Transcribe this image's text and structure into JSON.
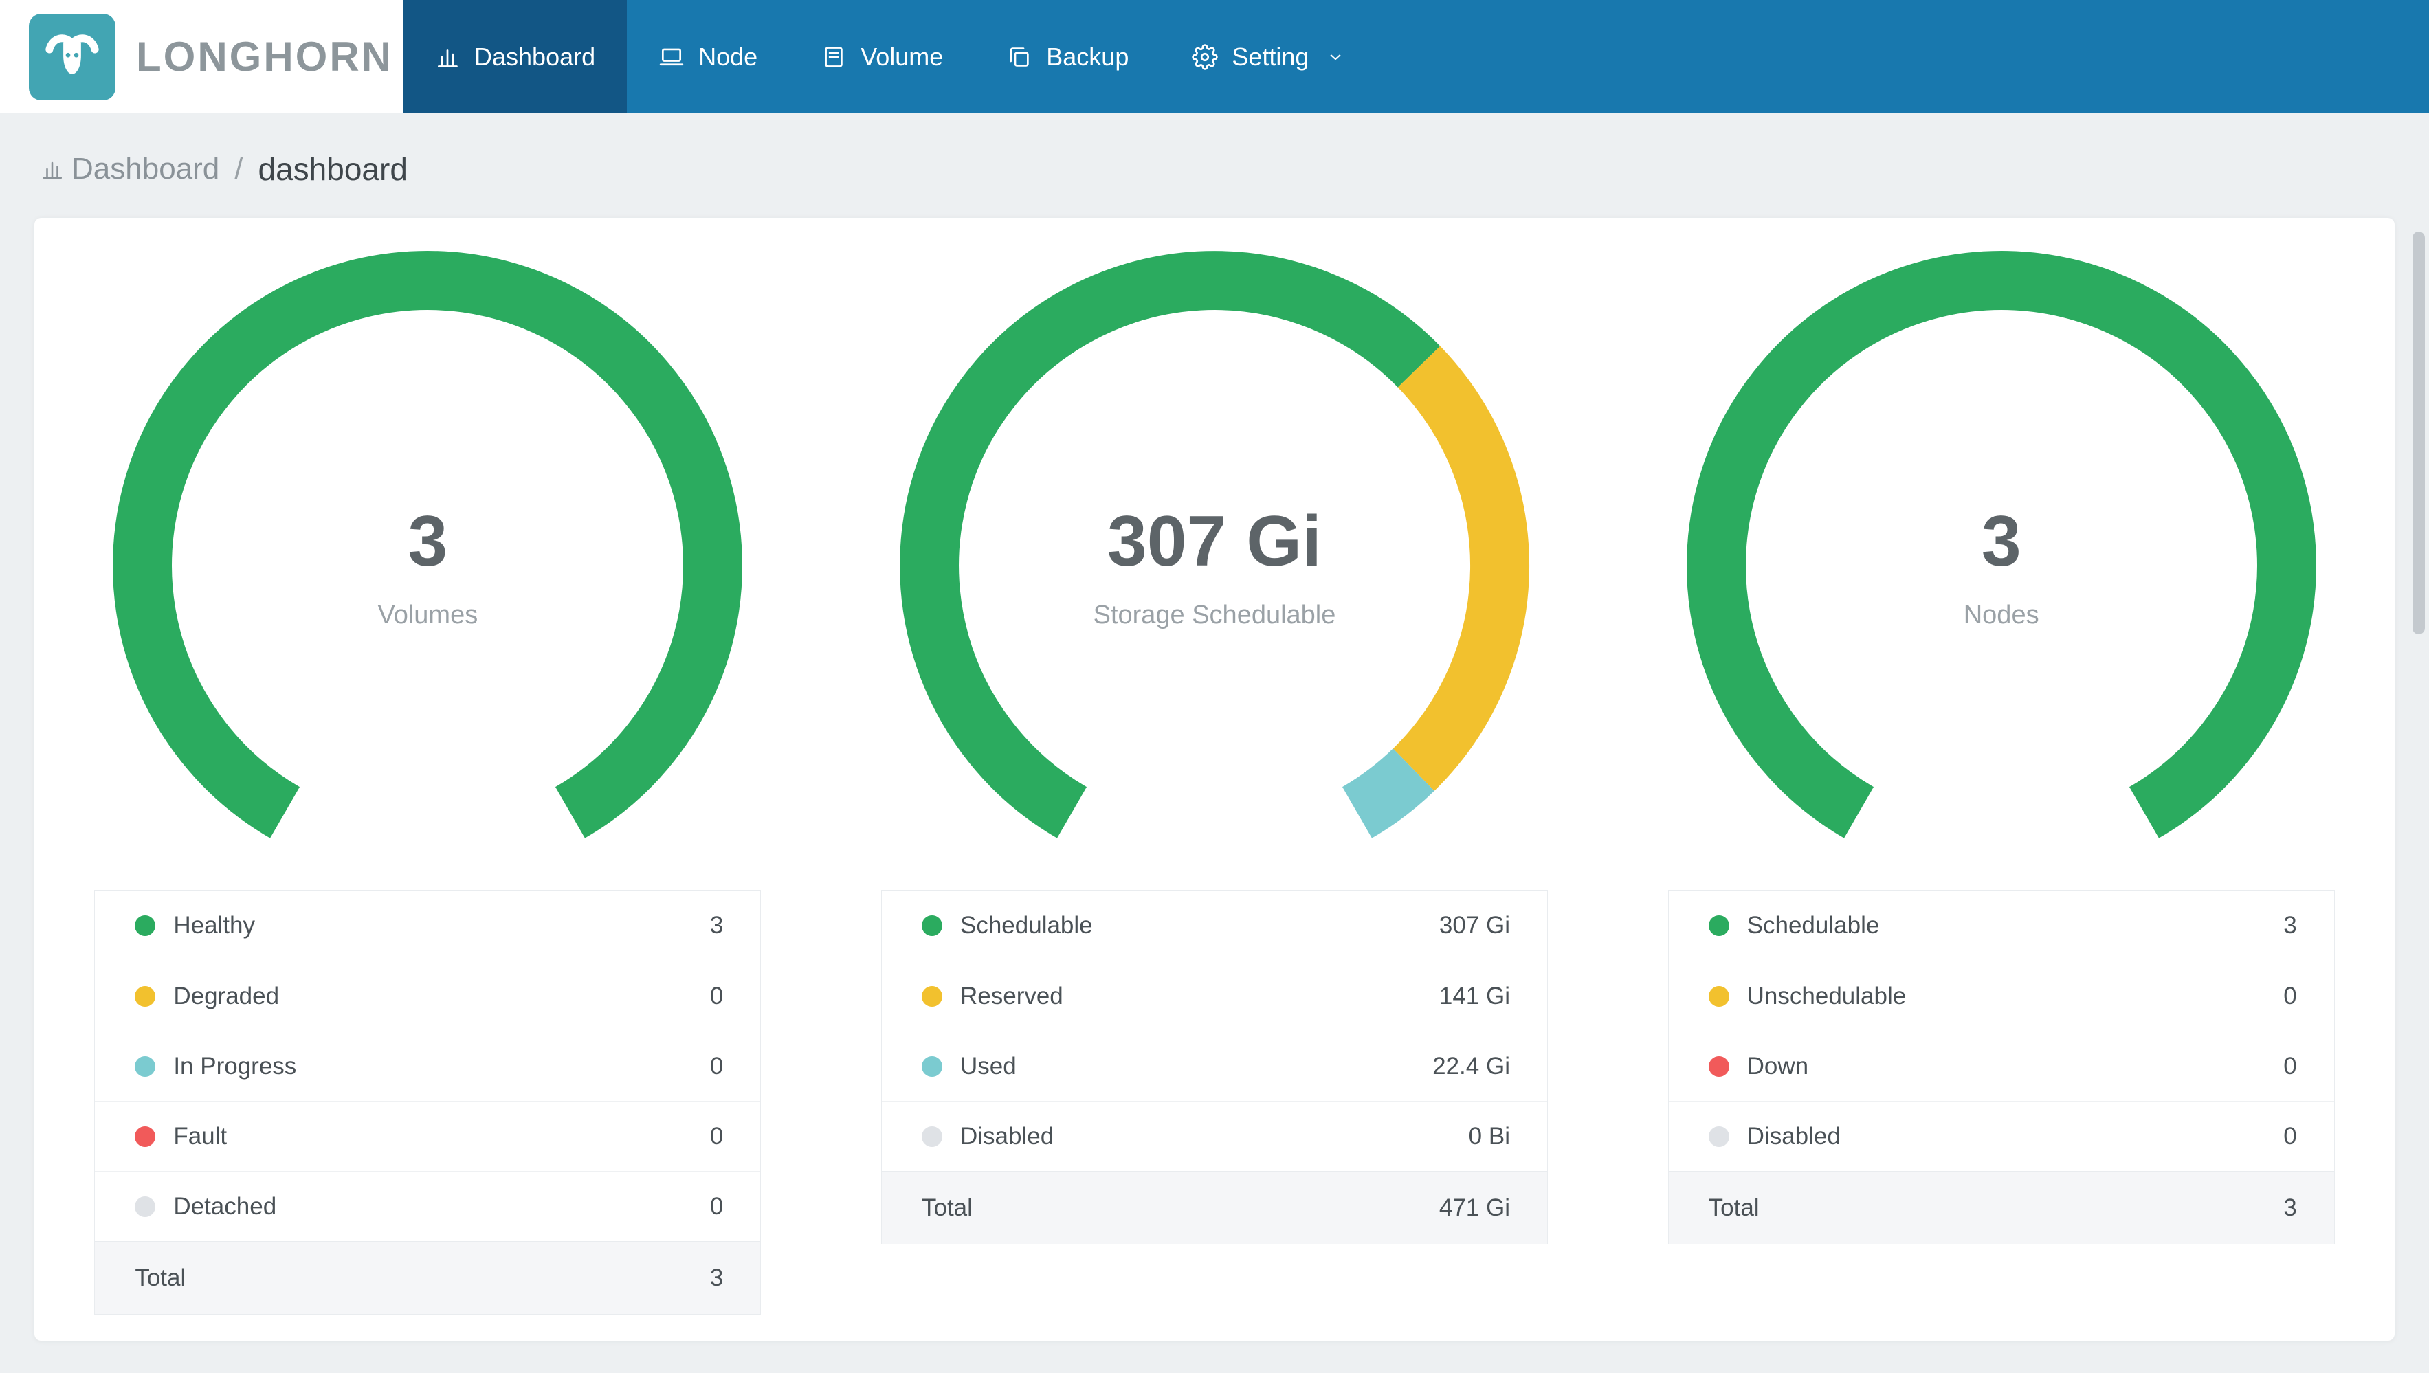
{
  "brand": {
    "name": "LONGHORN"
  },
  "colors": {
    "page_bg": "#EDF0F2",
    "nav_bg": "#1878AE",
    "nav_active": "#125685",
    "brand_teal": "#42A5B3",
    "brand_text": "#8D969B",
    "green": "#2BAB5F",
    "yellow": "#F2C12E",
    "teal": "#7BCBD0",
    "red": "#F15A5A",
    "gray": "#DFE2E6",
    "text_dark": "#4A5156",
    "text_muted": "#9AA1A6",
    "gauge_value": "#5D6468",
    "border": "#E9ECEF",
    "total_bg": "#F5F6F8"
  },
  "nav": {
    "items": [
      {
        "label": "Dashboard",
        "icon": "bar-chart",
        "active": true
      },
      {
        "label": "Node",
        "icon": "computer",
        "active": false
      },
      {
        "label": "Volume",
        "icon": "database",
        "active": false
      },
      {
        "label": "Backup",
        "icon": "copy",
        "active": false
      },
      {
        "label": "Setting",
        "icon": "gear",
        "active": false
      }
    ]
  },
  "breadcrumb": {
    "section": "Dashboard",
    "separator": "/",
    "page": "dashboard"
  },
  "chart_data": [
    {
      "type": "donut",
      "title": "Volumes",
      "center_value": "3",
      "center_label": "Volumes",
      "arc": {
        "start_deg": -150,
        "sweep_deg": 300,
        "thickness_px": 86
      },
      "segments": [
        {
          "label": "Healthy",
          "value": 3,
          "display": "3",
          "color": "#2BAB5F"
        },
        {
          "label": "Degraded",
          "value": 0,
          "display": "0",
          "color": "#F2C12E"
        },
        {
          "label": "In Progress",
          "value": 0,
          "display": "0",
          "color": "#7BCBD0"
        },
        {
          "label": "Fault",
          "value": 0,
          "display": "0",
          "color": "#F15A5A"
        },
        {
          "label": "Detached",
          "value": 0,
          "display": "0",
          "color": "#DFE2E6"
        }
      ],
      "total": {
        "label": "Total",
        "display": "3"
      }
    },
    {
      "type": "donut",
      "title": "Storage Schedulable",
      "center_value": "307 Gi",
      "center_label": "Storage Schedulable",
      "arc": {
        "start_deg": -150,
        "sweep_deg": 300,
        "thickness_px": 86
      },
      "segments": [
        {
          "label": "Schedulable",
          "value": 307,
          "display": "307 Gi",
          "color": "#2BAB5F"
        },
        {
          "label": "Reserved",
          "value": 141,
          "display": "141 Gi",
          "color": "#F2C12E"
        },
        {
          "label": "Used",
          "value": 22.4,
          "display": "22.4 Gi",
          "color": "#7BCBD0"
        },
        {
          "label": "Disabled",
          "value": 0,
          "display": "0 Bi",
          "color": "#DFE2E6"
        }
      ],
      "total": {
        "label": "Total",
        "display": "471 Gi"
      }
    },
    {
      "type": "donut",
      "title": "Nodes",
      "center_value": "3",
      "center_label": "Nodes",
      "arc": {
        "start_deg": -150,
        "sweep_deg": 300,
        "thickness_px": 86
      },
      "segments": [
        {
          "label": "Schedulable",
          "value": 3,
          "display": "3",
          "color": "#2BAB5F"
        },
        {
          "label": "Unschedulable",
          "value": 0,
          "display": "0",
          "color": "#F2C12E"
        },
        {
          "label": "Down",
          "value": 0,
          "display": "0",
          "color": "#F15A5A"
        },
        {
          "label": "Disabled",
          "value": 0,
          "display": "0",
          "color": "#DFE2E6"
        }
      ],
      "total": {
        "label": "Total",
        "display": "3"
      }
    }
  ]
}
